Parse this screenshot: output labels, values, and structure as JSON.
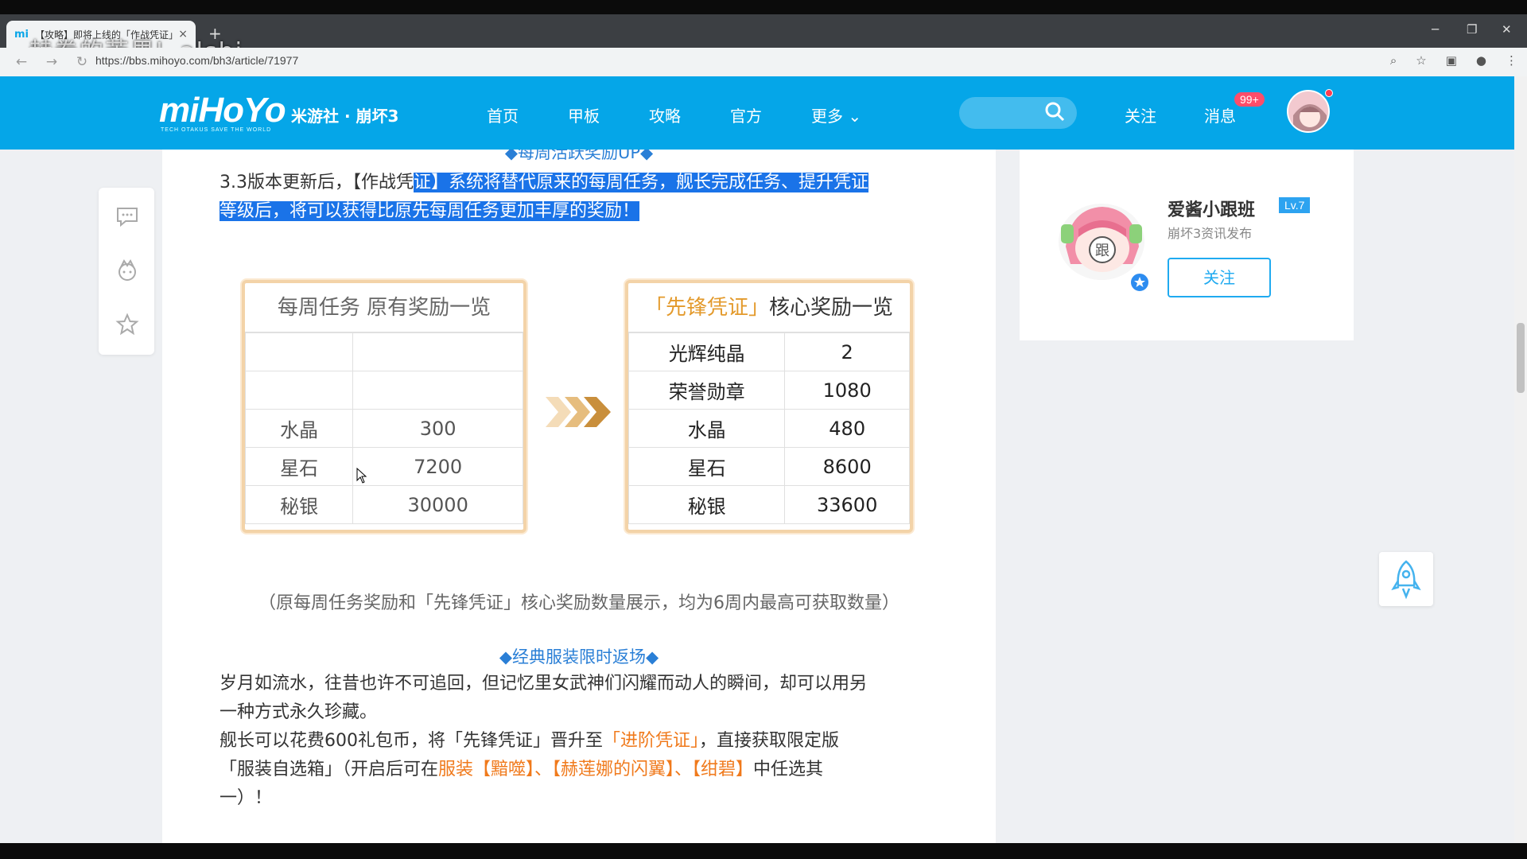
{
  "browser": {
    "tab_title": "【攻略】即将上线的「作战凭证」",
    "favicon_text": "mi",
    "url": "https://bbs.mihoyo.com/bh3/article/71977",
    "overlay": "赫卷的苦果L.alshi",
    "new_tab": "+",
    "close_tab": "×"
  },
  "header": {
    "logo": "miHoYo",
    "logo_tagline": "TECH OTAKUS SAVE THE WORLD",
    "site_name": "米游社 · 崩坏3",
    "nav": [
      "首页",
      "甲板",
      "攻略",
      "官方",
      "更多"
    ],
    "follow": "关注",
    "messages": "消息",
    "badge": "99+"
  },
  "article": {
    "section1_title": "◆每周活跃奖励UP◆",
    "p1_plain": "3.3版本更新后，【作战凭",
    "p1_hl1": "证】系统将替代原来的每周任务，舰长完成任务、提升凭证",
    "p1_hl2": "等级后，将可以获得比原先每周任务更加丰厚的奖励！",
    "table1": {
      "title": "每周任务 原有奖励一览",
      "rows": [
        [
          "",
          ""
        ],
        [
          "",
          ""
        ],
        [
          "水晶",
          "300"
        ],
        [
          "星石",
          "7200"
        ],
        [
          "秘银",
          "30000"
        ]
      ]
    },
    "table2": {
      "title_gold": "「先锋凭证」",
      "title_rest": "核心奖励一览",
      "rows": [
        [
          "光辉纯晶",
          "2"
        ],
        [
          "荣誉勋章",
          "1080"
        ],
        [
          "水晶",
          "480"
        ],
        [
          "星石",
          "8600"
        ],
        [
          "秘银",
          "33600"
        ]
      ]
    },
    "caption": "（原每周任务奖励和「先锋凭证」核心奖励数量展示，均为6周内最高可获取数量）",
    "section2_title": "◆经典服装限时返场◆",
    "p2_line1": "岁月如流水，往昔也许不可追回，但记忆里女武神们闪耀而动人的瞬间，却可以用另",
    "p2_line2": "一种方式永久珍藏。",
    "p3_a": "舰长可以花费600礼包币，将「先锋凭证」晋升至",
    "p3_b": "「进阶凭证」",
    "p3_c": "，直接获取限定版",
    "p4_a": "「服装自选箱」（开启后可在",
    "p4_b": "服装【黯噬】、【赫莲娜的闪翼】、【绀碧】",
    "p4_c": "中任选其",
    "p5": "一）！"
  },
  "author": {
    "name": "爱酱小跟班",
    "level": "Lv.7",
    "desc": "崩坏3资讯发布",
    "follow_btn": "关注"
  },
  "colors": {
    "brand": "#05a6e8",
    "highlight": "#1a73e8",
    "accent_orange": "#f07a1c"
  }
}
